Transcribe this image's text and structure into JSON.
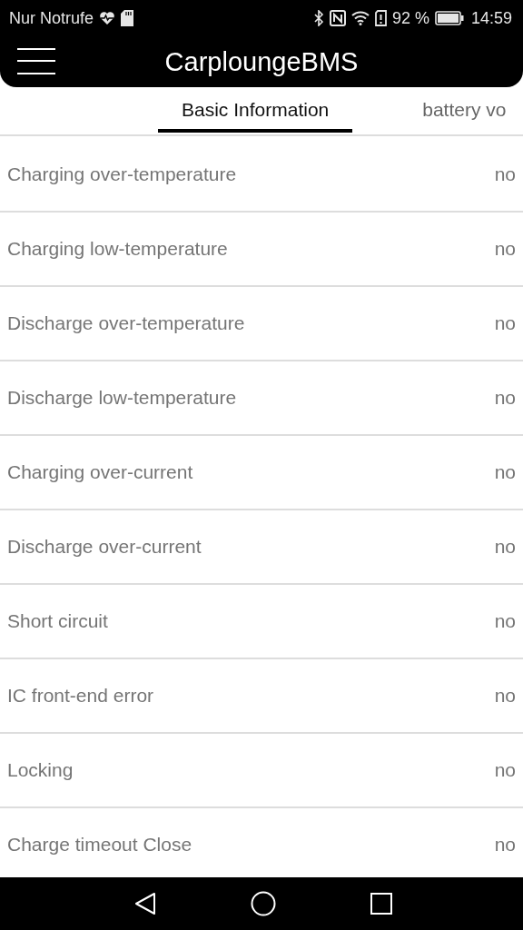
{
  "status_bar": {
    "carrier": "Nur Notrufe",
    "battery": "92 %",
    "time": "14:59"
  },
  "app_bar": {
    "title": "CarploungeBMS"
  },
  "tabs": [
    {
      "label": "Basic Information",
      "selected": true
    },
    {
      "label": "battery vo",
      "selected": false
    }
  ],
  "rows": [
    {
      "label": "Charging over-temperature",
      "value": "no"
    },
    {
      "label": "Charging low-temperature",
      "value": "no"
    },
    {
      "label": "Discharge over-temperature",
      "value": "no"
    },
    {
      "label": "Discharge low-temperature",
      "value": "no"
    },
    {
      "label": "Charging over-current",
      "value": "no"
    },
    {
      "label": "Discharge over-current",
      "value": "no"
    },
    {
      "label": "Short circuit",
      "value": "no"
    },
    {
      "label": "IC front-end error",
      "value": "no"
    },
    {
      "label": "Locking",
      "value": "no"
    },
    {
      "label": "Charge timeout Close",
      "value": "no"
    }
  ]
}
